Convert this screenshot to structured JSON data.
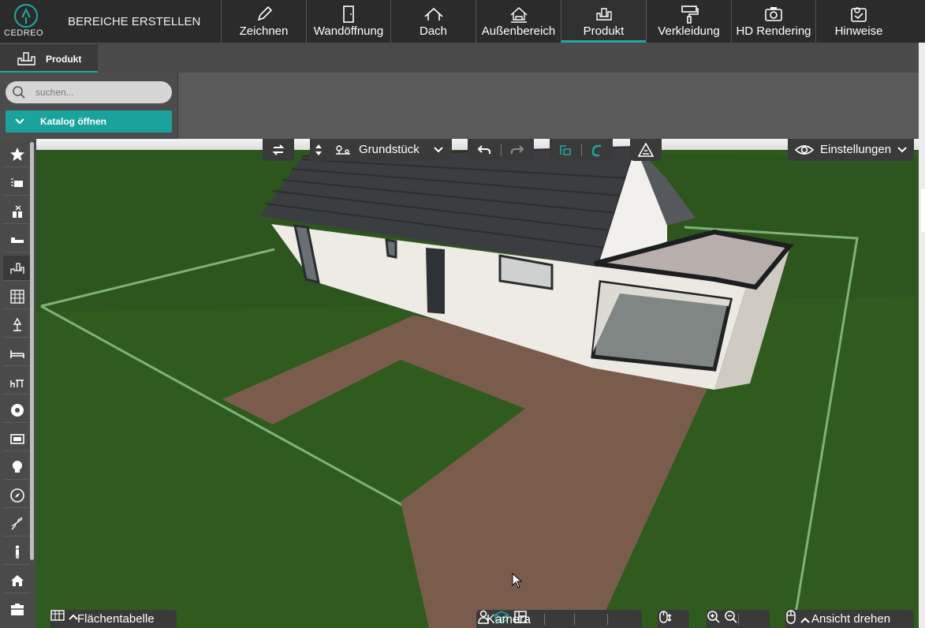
{
  "app": {
    "brand": "CEDREO",
    "title": "BEREICHE ERSTELLEN",
    "accent_color": "#1fa9a3"
  },
  "toolbar": {
    "tools": [
      {
        "label": "Zeichnen",
        "icon": "pencil-icon"
      },
      {
        "label": "Wandöffnung",
        "icon": "door-icon"
      },
      {
        "label": "Dach",
        "icon": "roof-icon"
      },
      {
        "label": "Außenbereich",
        "icon": "exterior-icon"
      },
      {
        "label": "Produkt",
        "icon": "furniture-icon",
        "active": true
      },
      {
        "label": "Verkleidung",
        "icon": "paint-roller-icon"
      },
      {
        "label": "HD Rendering",
        "icon": "camera-icon"
      },
      {
        "label": "Hinweise",
        "icon": "hints-icon"
      }
    ]
  },
  "tabs": {
    "produkt_label": "Produkt"
  },
  "catalog": {
    "search_placeholder": "suchen...",
    "open_label": "Katalog öffnen"
  },
  "sidebar": {
    "items": [
      "favorites-icon",
      "sofa-icon",
      "kitchen-icon",
      "bed-low-icon",
      "desk-icon",
      "shelf-icon",
      "lamp-stand-icon",
      "bed-icon",
      "dining-icon",
      "ball-icon",
      "tv-icon",
      "bulb-icon",
      "compass-icon",
      "stairs-icon",
      "person-icon",
      "house-icon",
      "storage-icon"
    ],
    "active_index": 4
  },
  "viewport": {
    "level_label": "Grundstück",
    "settings_label": "Einstellungen",
    "area_table_label": "Flächentabelle",
    "camera_label": "Kamera",
    "rotate_label": "Ansicht drehen"
  }
}
